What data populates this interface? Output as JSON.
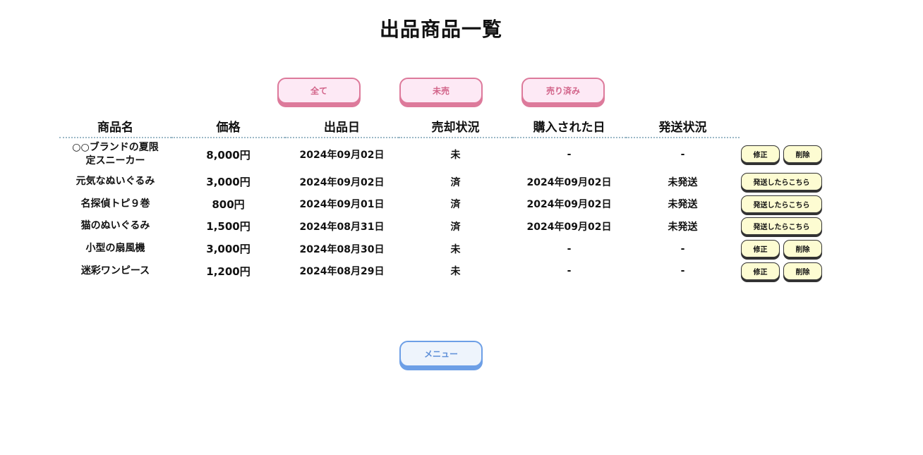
{
  "page": {
    "title": "出品商品一覧"
  },
  "filters": {
    "all_label": "全て",
    "unsold_label": "未売",
    "sold_label": "売り済み"
  },
  "table": {
    "headers": {
      "name": "商品名",
      "price": "価格",
      "listed_date": "出品日",
      "sale_status": "売却状況",
      "purchased_date": "購入された日",
      "shipping_status": "発送状況"
    },
    "rows": [
      {
        "name": "○○ブランドの夏限定スニーカー",
        "price": "8,000円",
        "listed_date": "2024年09月02日",
        "sale_status": "未",
        "purchased_date": "-",
        "shipping_status": "-",
        "actions": {
          "edit": "修正",
          "delete": "削除"
        }
      },
      {
        "name": "元気なぬいぐるみ",
        "price": "3,000円",
        "listed_date": "2024年09月02日",
        "sale_status": "済",
        "purchased_date": "2024年09月02日",
        "shipping_status": "未発送",
        "actions": {
          "ship": "発送したらこちら"
        }
      },
      {
        "name": "名探偵トピ９巻",
        "price": "800円",
        "listed_date": "2024年09月01日",
        "sale_status": "済",
        "purchased_date": "2024年09月02日",
        "shipping_status": "未発送",
        "actions": {
          "ship": "発送したらこちら"
        }
      },
      {
        "name": "猫のぬいぐるみ",
        "price": "1,500円",
        "listed_date": "2024年08月31日",
        "sale_status": "済",
        "purchased_date": "2024年09月02日",
        "shipping_status": "未発送",
        "actions": {
          "ship": "発送したらこちら"
        }
      },
      {
        "name": "小型の扇風機",
        "price": "3,000円",
        "listed_date": "2024年08月30日",
        "sale_status": "未",
        "purchased_date": "-",
        "shipping_status": "-",
        "actions": {
          "edit": "修正",
          "delete": "削除"
        }
      },
      {
        "name": "迷彩ワンピース",
        "price": "1,200円",
        "listed_date": "2024年08月29日",
        "sale_status": "未",
        "purchased_date": "-",
        "shipping_status": "-",
        "actions": {
          "edit": "修正",
          "delete": "削除"
        }
      }
    ]
  },
  "footer": {
    "menu_label": "メニュー"
  },
  "colors": {
    "filter_accent": "#dd7a9b",
    "filter_bg": "#fde9f5",
    "menu_accent": "#6d9fe6",
    "menu_bg": "#eef4fc",
    "action_bg": "#fdfcd2"
  }
}
